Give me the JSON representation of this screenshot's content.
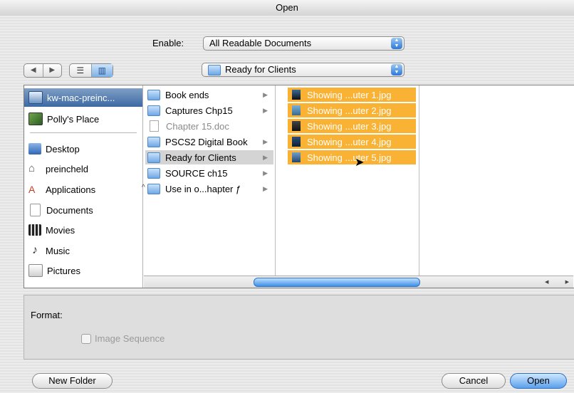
{
  "window": {
    "title": "Open"
  },
  "enable": {
    "label": "Enable:",
    "selected": "All Readable Documents"
  },
  "location": {
    "selected": "Ready for Clients"
  },
  "nav": {
    "back_icon": "back-arrow-icon",
    "forward_icon": "forward-arrow-icon",
    "list_icon": "list-view-icon",
    "column_icon": "column-view-icon"
  },
  "sidebar": {
    "devices": [
      {
        "label": "kw-mac-preinc...",
        "icon": "computer-icon",
        "selected": true
      },
      {
        "label": "Polly's Place",
        "icon": "network-volume-icon"
      }
    ],
    "places": [
      {
        "label": "Desktop",
        "icon": "desktop-icon"
      },
      {
        "label": "preincheld",
        "icon": "home-icon"
      },
      {
        "label": "Applications",
        "icon": "applications-icon"
      },
      {
        "label": "Documents",
        "icon": "documents-icon"
      },
      {
        "label": "Movies",
        "icon": "movies-icon"
      },
      {
        "label": "Music",
        "icon": "music-icon"
      },
      {
        "label": "Pictures",
        "icon": "pictures-icon"
      }
    ]
  },
  "column1": {
    "items": [
      {
        "label": "Book ends",
        "kind": "folder"
      },
      {
        "label": "Captures Chp15",
        "kind": "folder"
      },
      {
        "label": "Chapter 15.doc",
        "kind": "document"
      },
      {
        "label": "PSCS2 Digital Book",
        "kind": "folder"
      },
      {
        "label": "Ready for Clients",
        "kind": "folder",
        "selected": true
      },
      {
        "label": "SOURCE ch15",
        "kind": "folder"
      },
      {
        "label": "Use in o...hapter ƒ",
        "kind": "folder"
      }
    ]
  },
  "column2": {
    "items": [
      {
        "label": "Showing ...uter 1.jpg"
      },
      {
        "label": "Showing ...uter 2.jpg"
      },
      {
        "label": "Showing ...uter 3.jpg"
      },
      {
        "label": "Showing ...uter 4.jpg"
      },
      {
        "label": "Showing ...uter 5.jpg"
      }
    ]
  },
  "format": {
    "label": "Format:",
    "image_sequence_label": "Image Sequence",
    "image_sequence_checked": false
  },
  "buttons": {
    "new_folder": "New Folder",
    "cancel": "Cancel",
    "open": "Open"
  },
  "colors": {
    "selection": "#f9b233",
    "default_button": "#5aa0ec"
  }
}
